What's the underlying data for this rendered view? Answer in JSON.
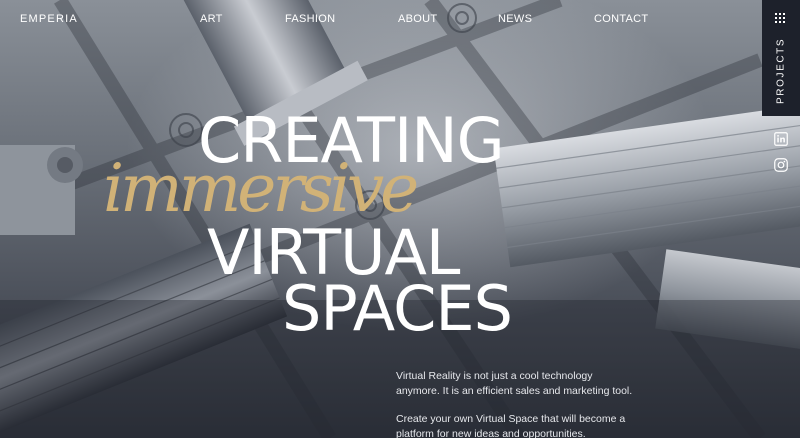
{
  "nav": {
    "logo": "EMPERIA",
    "items": [
      "ART",
      "FASHION",
      "ABOUT",
      "NEWS",
      "CONTACT"
    ]
  },
  "rail": {
    "projects_label": "PROJECTS",
    "icons": [
      "grid-icon",
      "linkedin-icon",
      "instagram-icon"
    ]
  },
  "hero": {
    "line1": "CREATING",
    "line2": "immersive",
    "line3": "VIRTUAL",
    "line4": "SPACES"
  },
  "copy": {
    "p1_line1": "Virtual Reality is not just a cool technology",
    "p1_line2": "anymore. It is an efficient sales and marketing tool.",
    "p2_line1": "Create your own Virtual Space that will become a",
    "p2_line2": "platform for new ideas and opportunities."
  },
  "colors": {
    "accent_gold": "#d1b277",
    "rail_dark": "#1d212b",
    "text": "#ffffff"
  }
}
